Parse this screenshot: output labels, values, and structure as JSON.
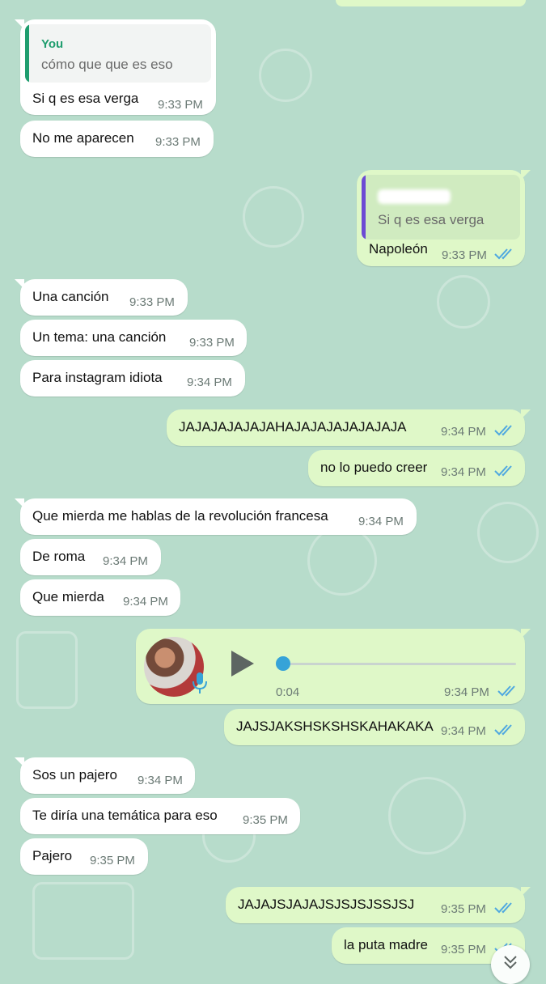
{
  "colors": {
    "incoming_bubble": "#ffffff",
    "outgoing_bubble": "#dff8c8",
    "wallpaper": "#b7dccb",
    "read_ticks": "#4fa8e0",
    "quote_bar_you": "#1f9d6e",
    "quote_bar_contact": "#6c4ad4"
  },
  "messages": [
    {
      "dir": "in",
      "quote": {
        "author": "You",
        "text": "cómo que que es eso"
      },
      "text": "Si q es esa verga",
      "time": "9:33 PM"
    },
    {
      "dir": "in",
      "text": "No me aparecen",
      "time": "9:33 PM"
    },
    {
      "dir": "out",
      "quote": {
        "author": "",
        "text": "Si q es esa verga"
      },
      "text": "Napoleón",
      "time": "9:33 PM",
      "status": "read"
    },
    {
      "dir": "in",
      "text": "Una canción",
      "time": "9:33 PM"
    },
    {
      "dir": "in",
      "text": "Un tema: una canción",
      "time": "9:33 PM"
    },
    {
      "dir": "in",
      "text": "Para instagram idiota",
      "time": "9:34 PM"
    },
    {
      "dir": "out",
      "text": "JAJAJAJAJAJAHAJAJAJAJAJAJAJA",
      "time": "9:34 PM",
      "status": "read"
    },
    {
      "dir": "out",
      "text": "no lo puedo creer",
      "time": "9:34 PM",
      "status": "read"
    },
    {
      "dir": "in",
      "text": "Que mierda me hablas de la revolución francesa",
      "time": "9:34 PM"
    },
    {
      "dir": "in",
      "text": "De roma",
      "time": "9:34 PM"
    },
    {
      "dir": "in",
      "text": "Que mierda",
      "time": "9:34 PM"
    },
    {
      "dir": "out",
      "type": "voice",
      "duration": "0:04",
      "playback_progress": 0.0,
      "time": "9:34 PM",
      "status": "read"
    },
    {
      "dir": "out",
      "text": "JAJSJAKSHSKSHSKAHAKAKA",
      "time": "9:34 PM",
      "status": "read"
    },
    {
      "dir": "in",
      "text": "Sos un pajero",
      "time": "9:34 PM"
    },
    {
      "dir": "in",
      "text": "Te diría una temática para eso",
      "time": "9:35 PM"
    },
    {
      "dir": "in",
      "text": "Pajero",
      "time": "9:35 PM"
    },
    {
      "dir": "out",
      "text": "JAJAJSJAJAJSJSJSJSSJSJ",
      "time": "9:35 PM",
      "status": "read"
    },
    {
      "dir": "out",
      "text": "la puta madre",
      "time": "9:35 PM",
      "status": "read"
    }
  ],
  "icons": {
    "read_status": "double-check-icon",
    "voice_play": "play-icon",
    "voice_mic": "mic-icon",
    "scroll_down": "chevron-double-down-icon"
  }
}
